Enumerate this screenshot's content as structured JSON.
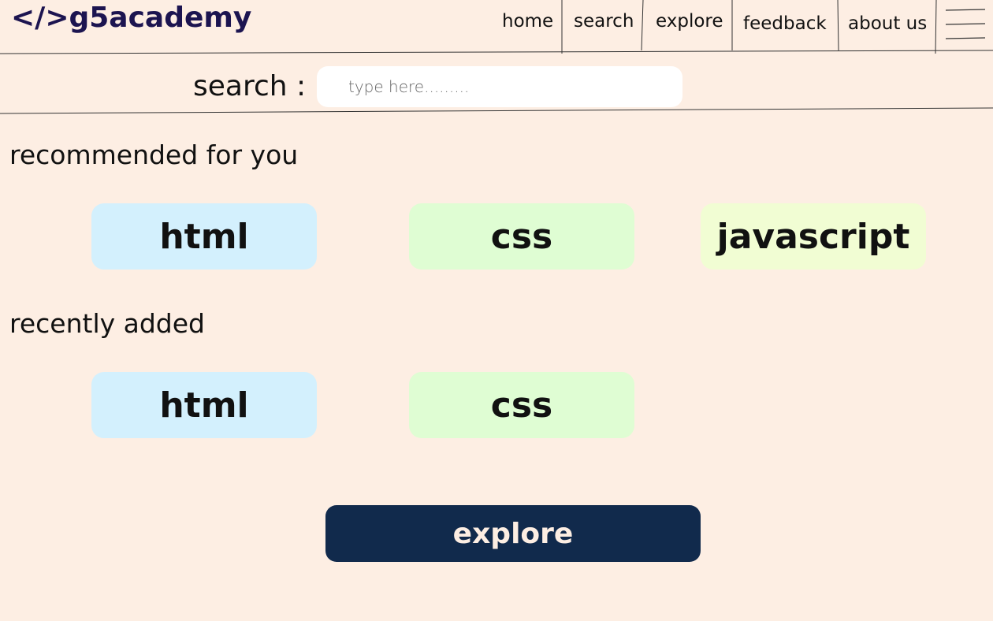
{
  "brand": {
    "logo_text": "</>g5academy"
  },
  "nav": {
    "items": [
      {
        "label": "home"
      },
      {
        "label": "search"
      },
      {
        "label": "explore"
      },
      {
        "label": "feedback"
      },
      {
        "label": "about us"
      }
    ],
    "menu_icon": "hamburger-menu-icon"
  },
  "search": {
    "label": "search :",
    "placeholder": "type here.........",
    "value": ""
  },
  "sections": {
    "recommended": {
      "title": "recommended for you",
      "cards": [
        {
          "label": "html",
          "color": "#d3f0fd"
        },
        {
          "label": "css",
          "color": "#dffdd3"
        },
        {
          "label": "javascript",
          "color": "#f1fdd3"
        }
      ]
    },
    "recent": {
      "title": "recently added",
      "cards": [
        {
          "label": "html",
          "color": "#d3f0fd"
        },
        {
          "label": "css",
          "color": "#dffdd3"
        }
      ]
    }
  },
  "explore_button": {
    "label": "explore",
    "color": "#112a4c"
  },
  "colors": {
    "background": "#fdeee3",
    "logo": "#1c1450"
  }
}
